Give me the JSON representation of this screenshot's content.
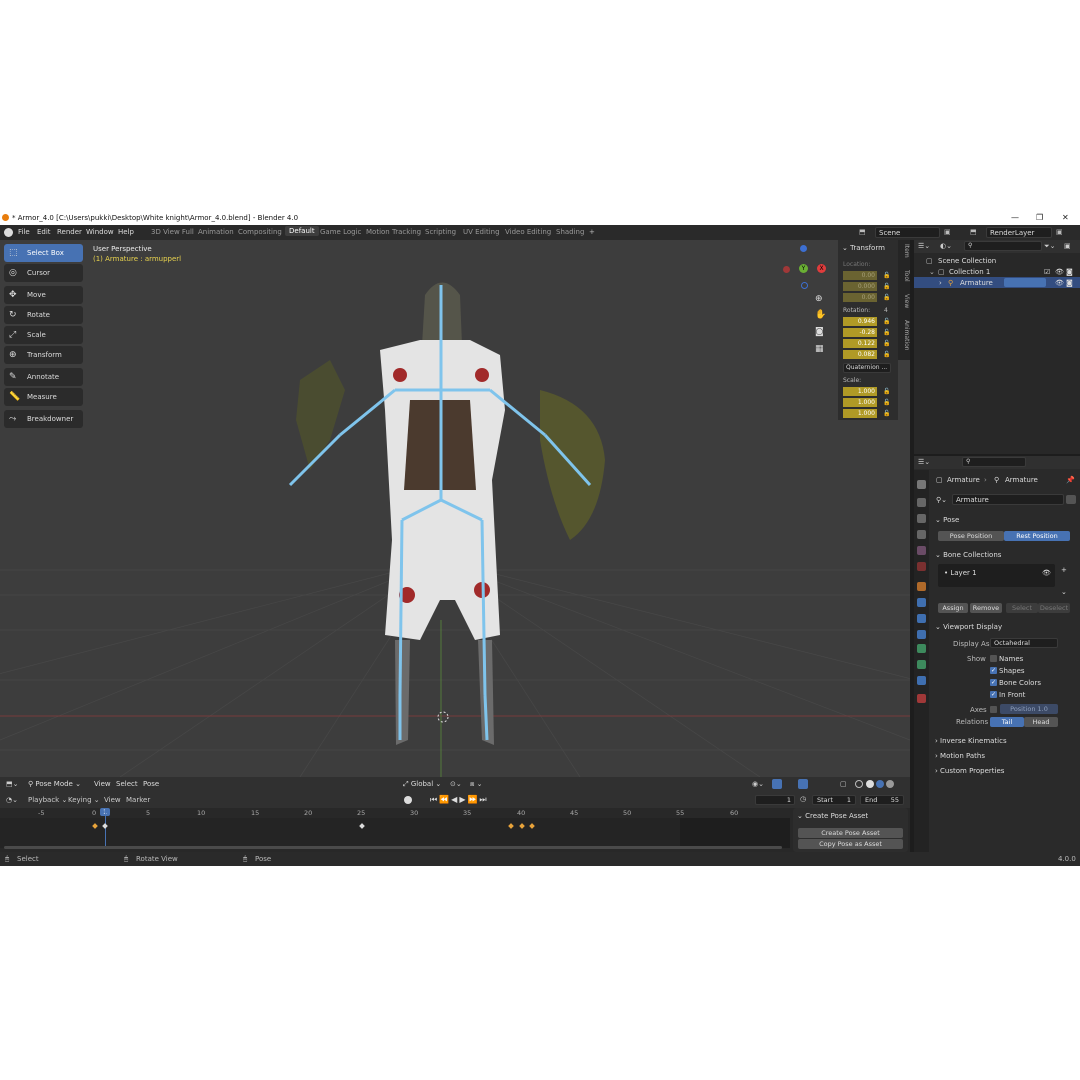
{
  "window": {
    "title": "* Armor_4.0 [C:\\Users\\pukki\\Desktop\\White knight\\Armor_4.0.blend] - Blender 4.0",
    "minimize": "—",
    "maximize": "❐",
    "close": "✕"
  },
  "menu": [
    "File",
    "Edit",
    "Render",
    "Window",
    "Help"
  ],
  "workspaces": [
    "3D View Full",
    "Animation",
    "Compositing",
    "Default",
    "Game Logic",
    "Motion Tracking",
    "Scripting",
    "UV Editing",
    "Video Editing",
    "Shading"
  ],
  "active_workspace": "Default",
  "scene": {
    "label": "Scene",
    "render_layer": "RenderLayer"
  },
  "tools": [
    "Select Box",
    "Cursor",
    "Move",
    "Rotate",
    "Scale",
    "Transform",
    "Annotate",
    "Measure",
    "Breakdowner"
  ],
  "viewport": {
    "perspective": "User Perspective",
    "object_info": "(1) Armature : armupperl",
    "gizmo": {
      "x": "X",
      "y": "Y",
      "z": "Z"
    }
  },
  "npanel": {
    "header": "Transform",
    "location_label": "Location:",
    "location": [
      "0.00",
      "0.000",
      "0.00"
    ],
    "rotation_label": "Rotation:",
    "rotation_mode_indicator": "4",
    "rotation": [
      "0.946",
      "-0.28",
      "0.122",
      "0.082"
    ],
    "rotation_mode": "Quaternion ...",
    "scale_label": "Scale:",
    "scale": [
      "1.000",
      "1.000",
      "1.000"
    ],
    "tabs": [
      "Item",
      "Tool",
      "View",
      "Animation"
    ]
  },
  "viewport_header": {
    "mode": "Pose Mode",
    "menus": [
      "View",
      "Select",
      "Pose"
    ],
    "orientation": "Global"
  },
  "timeline": {
    "menus": [
      "Playback",
      "Keying",
      "View",
      "Marker"
    ],
    "current_frame": "1",
    "start_label": "Start",
    "start": "1",
    "end_label": "End",
    "end": "55",
    "ticks": [
      "-5",
      "0",
      "1",
      "5",
      "10",
      "15",
      "20",
      "25",
      "30",
      "35",
      "40",
      "45",
      "50",
      "55",
      "60"
    ]
  },
  "pose_asset": {
    "header": "Create Pose Asset",
    "create_btn": "Create Pose Asset",
    "copy_btn": "Copy Pose as Asset"
  },
  "statusbar": {
    "select": "Select",
    "rotate": "Rotate View",
    "pose": "Pose",
    "version": "4.0.0"
  },
  "outliner": {
    "root": "Scene Collection",
    "collection": "Collection 1",
    "armature": "Armature"
  },
  "properties": {
    "breadcrumb_a": "Armature",
    "breadcrumb_b": "Armature",
    "data_name": "Armature",
    "pose_section": "Pose",
    "pose_position": "Pose Position",
    "rest_position": "Rest Position",
    "bone_collections": "Bone Collections",
    "layer": "Layer 1",
    "assign": "Assign",
    "remove": "Remove",
    "select": "Select",
    "deselect": "Deselect",
    "viewport_display": "Viewport Display",
    "display_as_label": "Display As",
    "display_as": "Octahedral",
    "show_label": "Show",
    "names": "Names",
    "shapes": "Shapes",
    "bone_colors": "Bone Colors",
    "in_front": "In Front",
    "axes_label": "Axes",
    "axes_position": "Position",
    "axes_value": "1.0",
    "relations_label": "Relations",
    "tail": "Tail",
    "head": "Head",
    "inverse_kinematics": "Inverse Kinematics",
    "motion_paths": "Motion Paths",
    "custom_properties": "Custom Properties"
  },
  "colors": {
    "accent": "#4772b3",
    "keyframe": "#e8a33a",
    "field_yellow": "#b09a26"
  }
}
